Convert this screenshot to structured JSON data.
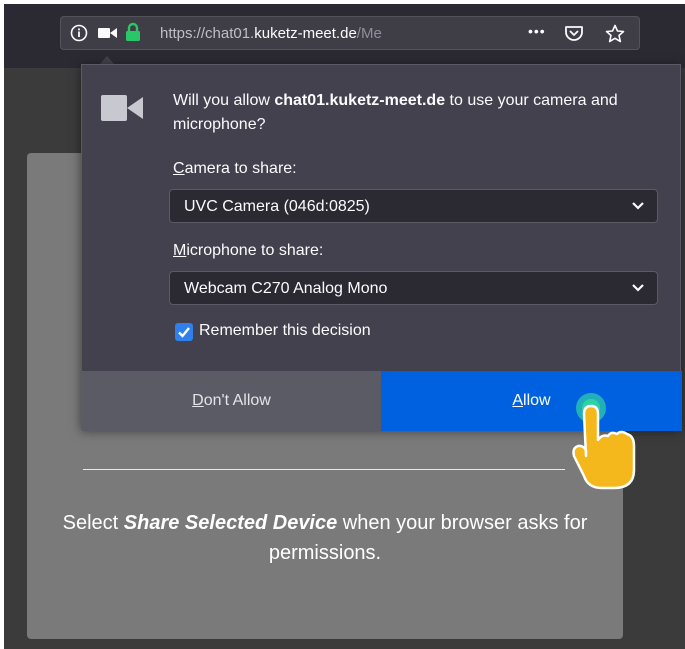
{
  "browser": {
    "url_prefix": "https://chat01.",
    "url_host": "kuketz-meet.de",
    "url_path": "/Me",
    "more_label": "•••"
  },
  "permission_prompt": {
    "question_start": "Will you allow ",
    "site": "chat01.kuketz-meet.de",
    "question_end": " to use your camera and microphone?",
    "camera_label_first": "C",
    "camera_label_rest": "amera to share:",
    "camera_value": "UVC Camera (046d:0825)",
    "microphone_label_first": "M",
    "microphone_label_rest": "icrophone to share:",
    "microphone_value": "Webcam C270 Analog Mono",
    "remember_label": "Remember this decision",
    "remember_checked": true,
    "deny_first": "D",
    "deny_rest": "on't Allow",
    "allow_first": "A",
    "allow_rest": "llow"
  },
  "page": {
    "instruction_start": "Select ",
    "instruction_bold": "Share Selected Device",
    "instruction_end": " when your browser asks for permissions."
  },
  "colors": {
    "allow_button": "#0061e0",
    "secure_lock": "#2ac769",
    "checkbox": "#2f80ed"
  }
}
